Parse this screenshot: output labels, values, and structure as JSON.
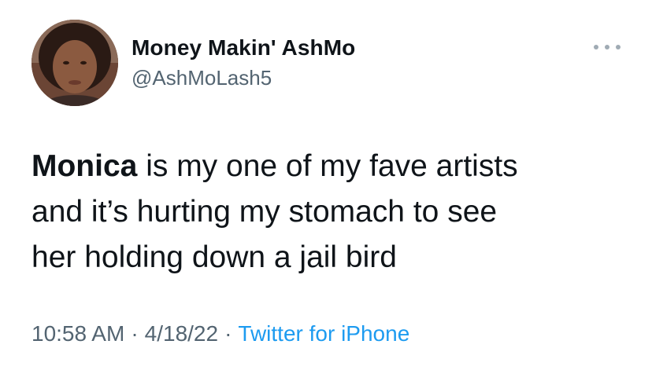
{
  "user": {
    "display_name": "Money Makin' AshMo",
    "handle": "@AshMoLash5"
  },
  "tweet": {
    "lines": [
      {
        "bold": "Monica",
        "rest": " is my one of my fave artists"
      },
      {
        "bold": "",
        "rest": "and it’s hurting my stomach to see"
      },
      {
        "bold": "",
        "rest": "her holding down a jail bird"
      }
    ]
  },
  "meta": {
    "time": "10:58 AM",
    "separator": "·",
    "date": "4/18/22",
    "source": "Twitter for iPhone"
  },
  "icons": {
    "more": "more-horizontal-icon"
  },
  "colors": {
    "text": "#0f1419",
    "secondary": "#536471",
    "link": "#1d9bf0"
  }
}
